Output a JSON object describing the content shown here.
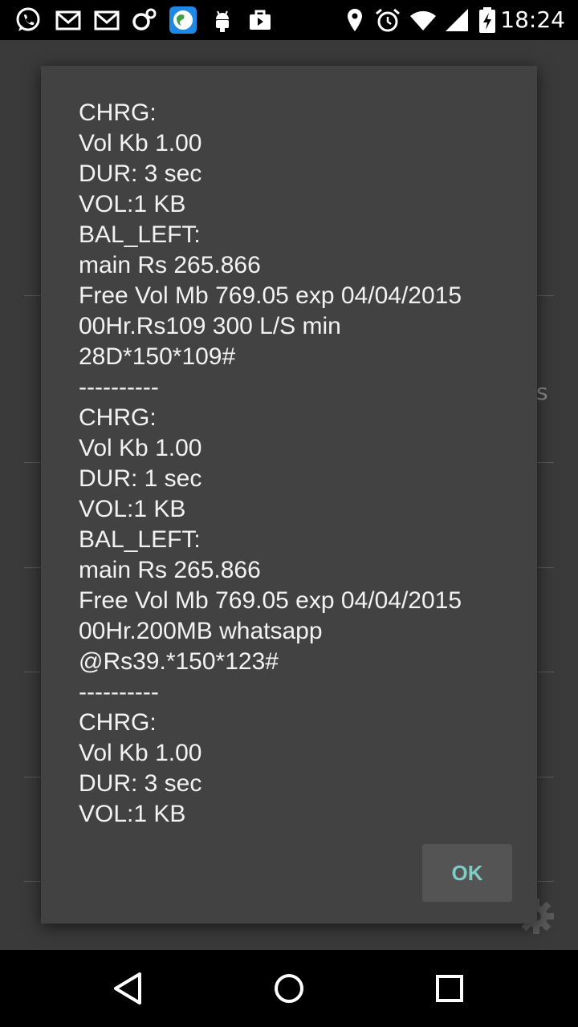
{
  "status_bar": {
    "time": "18:24",
    "left_icons": [
      "whatsapp-icon",
      "gmail-icon",
      "gmail-icon",
      "app-icon",
      "browser-icon",
      "android-debug-icon",
      "play-store-icon"
    ],
    "right_icons": [
      "location-icon",
      "alarm-icon",
      "wifi-icon",
      "signal-icon",
      "battery-charging-icon"
    ]
  },
  "dialog": {
    "lines": [
      "CHRG:",
      "Vol Kb 1.00",
      "DUR: 3 sec",
      "VOL:1 KB",
      "BAL_LEFT:",
      "main Rs 265.866",
      "Free Vol Mb 769.05 exp 04/04/2015",
      "00Hr.Rs109 300 L/S min",
      "28D*150*109#",
      "----------",
      "CHRG:",
      "Vol Kb 1.00",
      "DUR: 1 sec",
      "VOL:1 KB",
      "BAL_LEFT:",
      "main Rs 265.866",
      "Free Vol Mb 769.05 exp 04/04/2015",
      "00Hr.200MB whatsapp",
      "@Rs39.*150*123#",
      "----------",
      "CHRG:",
      "Vol Kb 1.00",
      "DUR: 3 sec",
      "VOL:1 KB"
    ],
    "ok_label": "OK"
  },
  "background": {
    "edge_text": "s"
  },
  "colors": {
    "dialog_bg": "#424242",
    "accent": "#80cbc4"
  }
}
